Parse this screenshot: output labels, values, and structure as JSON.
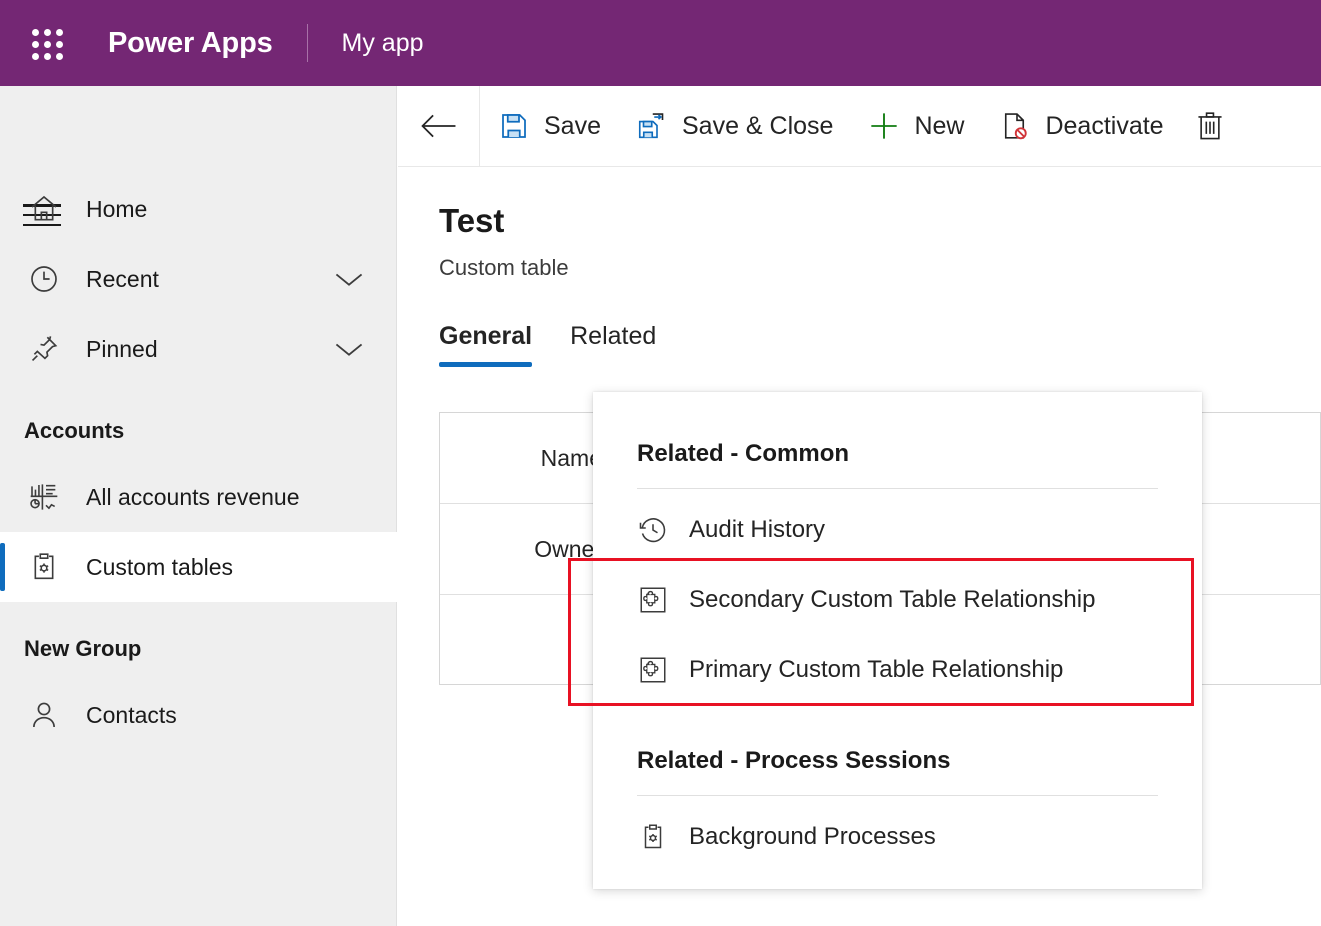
{
  "topbar": {
    "waffle_icon": "waffle-grid-icon",
    "brand": "Power Apps",
    "app_name": "My app",
    "background_color": "#742774"
  },
  "sidebar": {
    "menu_icon": "hamburger-menu-icon",
    "background_color": "#efefef",
    "selected_indicator_color": "#0f6cbd",
    "items": [
      {
        "label": "Home",
        "icon": "home-icon",
        "chevron": false,
        "selected": false
      },
      {
        "label": "Recent",
        "icon": "clock-icon",
        "chevron": true,
        "selected": false
      },
      {
        "label": "Pinned",
        "icon": "pin-icon",
        "chevron": true,
        "selected": false
      }
    ],
    "groups": [
      {
        "header": "Accounts",
        "items": [
          {
            "label": "All accounts revenue",
            "icon": "dashboard-chart-icon",
            "selected": false
          },
          {
            "label": "Custom tables",
            "icon": "clipboard-gear-icon",
            "selected": true
          }
        ]
      },
      {
        "header": "New Group",
        "items": [
          {
            "label": "Contacts",
            "icon": "person-icon",
            "selected": false
          }
        ]
      }
    ]
  },
  "command_bar": {
    "back_icon": "back-arrow-icon",
    "buttons": [
      {
        "label": "Save",
        "icon": "save-floppy-icon"
      },
      {
        "label": "Save & Close",
        "icon": "save-and-close-icon"
      },
      {
        "label": "New",
        "icon": "plus-icon"
      },
      {
        "label": "Deactivate",
        "icon": "deactivate-icon"
      }
    ],
    "delete_icon": "trash-icon"
  },
  "main": {
    "title": "Test",
    "subtitle": "Custom table",
    "tabs": [
      {
        "label": "General",
        "active": true
      },
      {
        "label": "Related",
        "active": false
      }
    ],
    "form_fields": [
      {
        "label": "Name",
        "value": ""
      },
      {
        "label": "Owner",
        "value": ""
      },
      {
        "label": "",
        "value": ""
      }
    ]
  },
  "related_panel": {
    "sections": [
      {
        "title": "Related - Common",
        "items": [
          {
            "label": "Audit History",
            "icon": "history-icon",
            "highlighted": false
          },
          {
            "label": "Secondary Custom Table Relationship",
            "icon": "puzzle-piece-icon",
            "highlighted": true
          },
          {
            "label": "Primary Custom Table Relationship",
            "icon": "puzzle-piece-icon",
            "highlighted": true
          }
        ]
      },
      {
        "title": "Related - Process Sessions",
        "items": [
          {
            "label": "Background Processes",
            "icon": "clipboard-gear-icon",
            "highlighted": false
          }
        ]
      }
    ],
    "highlight_color": "#e81123"
  }
}
